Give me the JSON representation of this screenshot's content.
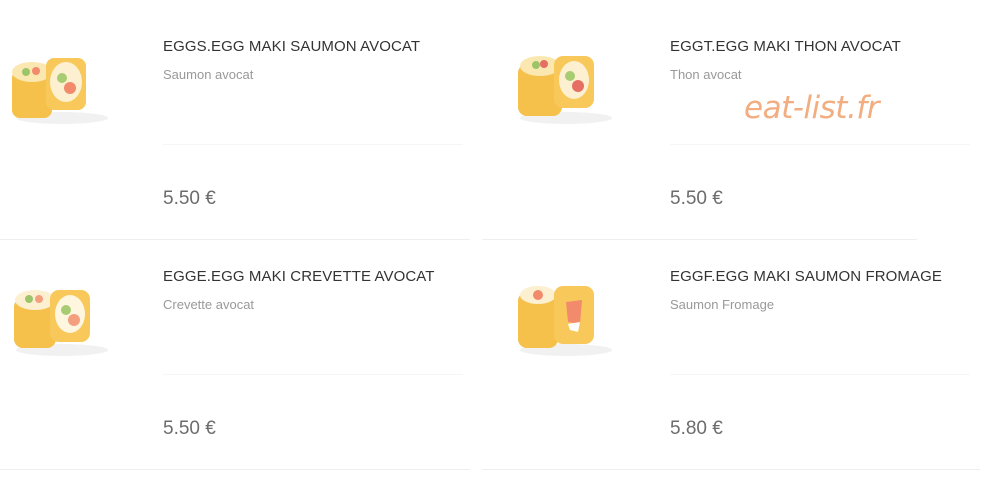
{
  "watermark": "eat-list.fr",
  "items": [
    {
      "title": "EGGS.EGG MAKI SAUMON AVOCAT",
      "description": "Saumon avocat",
      "price": "5.50 €",
      "image": "egg-maki-salmon-avocado-roll"
    },
    {
      "title": "EGGT.EGG MAKI THON AVOCAT",
      "description": "Thon avocat",
      "price": "5.50 €",
      "image": "egg-maki-tuna-avocado-roll"
    },
    {
      "title": "EGGE.EGG MAKI CREVETTE AVOCAT",
      "description": "Crevette avocat",
      "price": "5.50 €",
      "image": "egg-maki-shrimp-avocado-roll"
    },
    {
      "title": "EGGF.EGG MAKI SAUMON FROMAGE",
      "description": "Saumon Fromage",
      "price": "5.80 €",
      "image": "egg-maki-salmon-cheese-roll"
    }
  ],
  "colors": {
    "egg": "#f6c14a",
    "egg_light": "#fbd774",
    "salmon": "#f28a6c",
    "watermark": "#f2ad80"
  }
}
